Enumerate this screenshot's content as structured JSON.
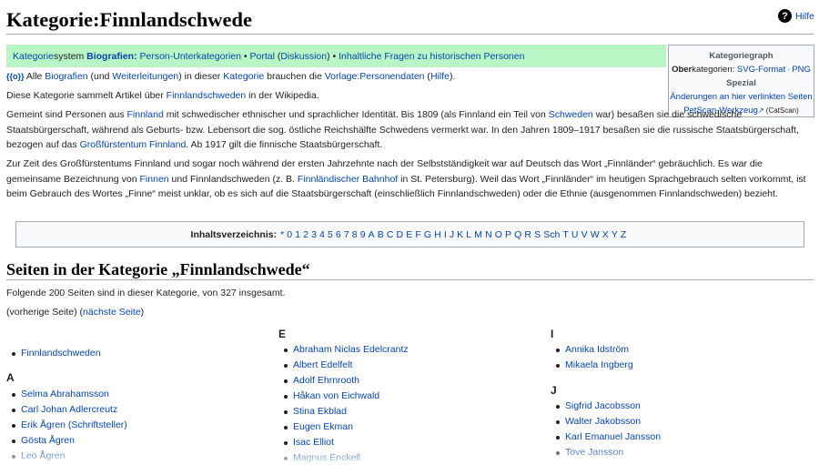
{
  "page_title": "Kategorie:Finnlandschwede",
  "help_label": "Hilfe",
  "banner": {
    "kategorie": "Kategorie",
    "system": "system",
    "biografien": "Biografien:",
    "person_unterkategorien": "Person-Unterkategorien",
    "sep1": " • ",
    "portal": "Portal",
    "diskussion_open": " (",
    "diskussion": "Diskussion",
    "diskussion_close": ")",
    "sep2": " • ",
    "fragen": "Inhaltliche Fragen zu historischen Personen"
  },
  "catbox": {
    "heading": "Kategoriegraph",
    "ober_prefix": "Ober",
    "ober_rest": "kategorien: ",
    "svg": "SVG-Format",
    "dot": " · ",
    "png": "PNG",
    "spezial": "Spezial",
    "aenderungen": "Änderungen an hier verlinkten Seiten",
    "petscan": "PetScan-Werkzeug",
    "catscan": " (CatScan)"
  },
  "personendaten_line": {
    "templ": "{{o}}",
    "alle": " Alle ",
    "biografien": "Biografien",
    "und_open": " (und ",
    "weiterleitungen": "Weiterleitungen",
    "in_dieser": ") in dieser ",
    "kategorie": "Kategorie",
    "brauchen": " brauchen die ",
    "vorlage": "Vorlage:Personendaten",
    "hilfe_open": " (",
    "hilfe": "Hilfe",
    "hilfe_close": ")."
  },
  "intro": {
    "pre": "Diese Kategorie sammelt Artikel über ",
    "link": "Finnlandschweden",
    "post": " in der Wikipedia."
  },
  "para1": {
    "a": "Gemeint sind Personen aus ",
    "finnland": "Finnland",
    "b": " mit schwedischer ethnischer und sprachlicher Identität. Bis 1809 (als Finnland ein Teil von ",
    "schweden": "Schweden",
    "c": " war) besaßen sie die schwedische Staatsbürgerschaft, während als Geburts- bzw. Lebensort die sog. östliche Reichshälfte Schwedens vermerkt war. In den Jahren 1809–1917 besaßen sie die russische Staatsbürgerschaft, bezogen auf das ",
    "gf": "Großfürstentum Finnland",
    "d": ". Ab 1917 gilt die finnische Staatsbürgerschaft."
  },
  "para2": {
    "a": "Zur Zeit des Großfürstentums Finnland und sogar noch während der ersten Jahrzehnte nach der Selbstständigkeit war auf Deutsch das Wort „Finnländer“ gebräuchlich. Es war die gemeinsame Bezeichnung von ",
    "finnen": "Finnen",
    "b": " und Finnlandschweden (z. B. ",
    "bahnhof": "Finnländischer Bahnhof",
    "c": " in St. Petersburg). Weil das Wort „Finnländer“ im heutigen Sprachgebrauch selten vorkommt, ist beim Gebrauch des Wortes „Finne“ meist unklar, ob es sich auf die Staatsbürgerschaft (einschließlich Finnlandschweden) oder die Ethnie (ausgenommen Finnlandschweden) bezieht."
  },
  "toc": {
    "label": "Inhaltsverzeichnis:",
    "items": [
      "*",
      "0",
      "1",
      "2",
      "3",
      "4",
      "5",
      "6",
      "7",
      "8",
      "9",
      "A",
      "B",
      "C",
      "D",
      "E",
      "F",
      "G",
      "H",
      "I",
      "J",
      "K",
      "L",
      "M",
      "N",
      "O",
      "P",
      "Q",
      "R",
      "S",
      "Sch",
      "T",
      "U",
      "V",
      "W",
      "X",
      "Y",
      "Z"
    ]
  },
  "section": {
    "heading": "Seiten in der Kategorie „Finnlandschwede“",
    "count_text": "Folgende 200 Seiten sind in dieser Kategorie, von 327 insgesamt.",
    "prev": "(vorherige Seite) (",
    "next": "nächste Seite",
    "next_close": ")"
  },
  "columns": [
    {
      "groups": [
        {
          "letter": "",
          "items": [
            "Finnlandschweden"
          ]
        },
        {
          "letter": "A",
          "items": [
            "Selma Abrahamsson",
            "Carl Johan Adlercreutz",
            "Erik Ågren (Schriftsteller)",
            "Gösta Ågren",
            "Leo Ågren"
          ]
        }
      ]
    },
    {
      "groups": [
        {
          "letter": "E",
          "items": [
            "Abraham Niclas Edelcrantz",
            "Albert Edelfelt",
            "Adolf Ehrnrooth",
            "Håkan von Eichwald",
            "Stina Ekblad",
            "Eugen Ekman",
            "Isac Elliot",
            "Magnus Enckell"
          ]
        }
      ]
    },
    {
      "groups": [
        {
          "letter": "I",
          "items": [
            "Annika Idström",
            "Mikaela Ingberg"
          ]
        },
        {
          "letter": "J",
          "items": [
            "Sigfrid Jacobsson",
            "Walter Jakobsson",
            "Karl Emanuel Jansson",
            "Tove Jansson"
          ]
        }
      ]
    }
  ]
}
